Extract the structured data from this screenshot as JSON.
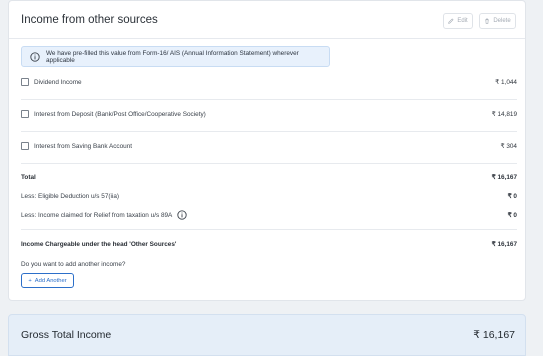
{
  "section": {
    "title": "Income from other sources",
    "edit_label": "Edit",
    "delete_label": "Delete"
  },
  "info_banner": "We have pre-filled this value from Form-16/ AIS (Annual Information Statement) wherever applicable",
  "income_items": [
    {
      "label": "Dividend Income",
      "amount": "₹ 1,044",
      "checked": false
    },
    {
      "label": "Interest from Deposit (Bank/Post Office/Cooperative Society)",
      "amount": "₹ 14,819",
      "checked": false
    },
    {
      "label": "Interest from Saving Bank Account",
      "amount": "₹ 304",
      "checked": false
    }
  ],
  "total": {
    "label": "Total",
    "amount": "₹ 16,167"
  },
  "deduction_57": {
    "label": "Less: Eligible Deduction u/s 57(iia)",
    "amount": "₹ 0"
  },
  "relief_89a": {
    "label": "Less: Income claimed for Relief from taxation u/s 89A",
    "amount": "₹ 0"
  },
  "chargeable": {
    "label": "Income Chargeable under the head 'Other Sources'",
    "amount": "₹ 16,167"
  },
  "add_prompt": "Do you want to add another income?",
  "add_button": "Add Another",
  "gross": {
    "label": "Gross Total Income",
    "amount": "₹ 16,167"
  },
  "icons": {
    "edit": "pencil-icon",
    "delete": "trash-icon",
    "info": "info-circle-icon",
    "add": "plus-icon"
  },
  "colors": {
    "accent": "#2c6fc9",
    "banner_bg": "#e8f1fc",
    "gross_bg": "#e5eef8"
  }
}
